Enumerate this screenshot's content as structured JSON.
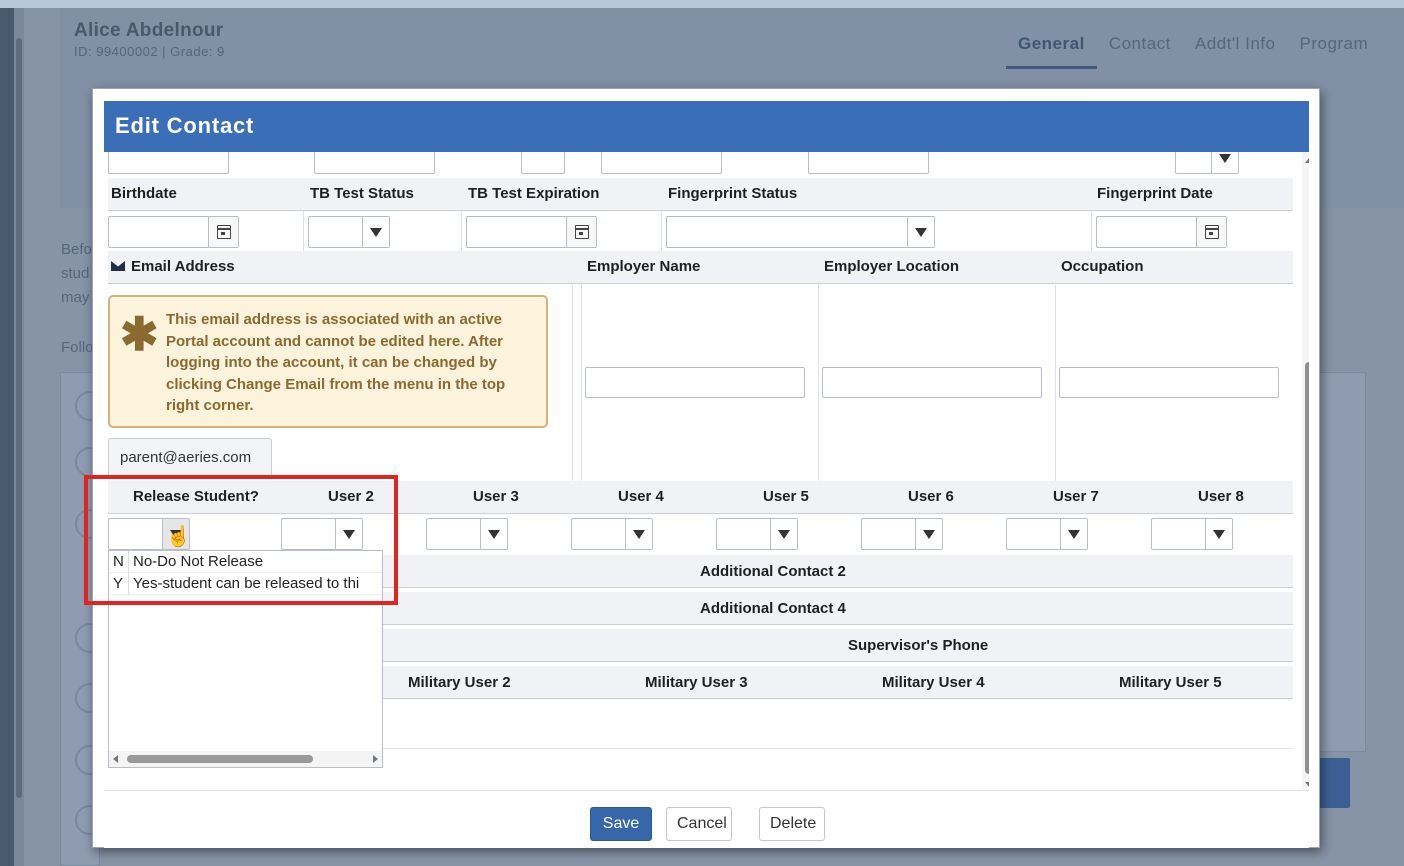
{
  "student": {
    "name": "Alice Abdelnour",
    "id_line": "ID: 99400002 |  Grade: 9"
  },
  "background_tabs": [
    "General",
    "Contact",
    "Addt'l Info",
    "Program"
  ],
  "background_text": [
    "Befo",
    "stud",
    "may",
    "Follo"
  ],
  "modal": {
    "title": "Edit Contact",
    "row1_headers": {
      "birthdate": "Birthdate",
      "tb_status": "TB Test Status",
      "tb_expiration": "TB Test Expiration",
      "fingerprint_status": "Fingerprint Status",
      "fingerprint_date": "Fingerprint Date"
    },
    "row2_headers": {
      "email": "Email Address",
      "employer_name": "Employer Name",
      "employer_location": "Employer Location",
      "occupation": "Occupation"
    },
    "warning_text": "This email address is associated with an active Portal account and cannot be edited here. After logging into the account, it can be changed by clicking Change Email from the menu in the top right corner.",
    "email_value": "parent@aeries.com",
    "row3_headers": {
      "release_student": "Release Student?",
      "user2": "User 2",
      "user3": "User 3",
      "user4": "User 4",
      "user5": "User 5",
      "user6": "User 6",
      "user7": "User 7",
      "user8": "User 8"
    },
    "release_options": [
      {
        "code": "N",
        "label": "No-Do Not Release"
      },
      {
        "code": "Y",
        "label": "Yes-student can be released to thi"
      }
    ],
    "groups": {
      "additional_contact_2": "Additional Contact 2",
      "additional_contact_4": "Additional Contact 4",
      "supervisor_phone": "Supervisor's Phone",
      "military_user_2": "Military User 2",
      "military_user_3": "Military User 3",
      "military_user_4": "Military User 4",
      "military_user_5": "Military User 5"
    },
    "buttons": {
      "save": "Save",
      "cancel": "Cancel",
      "delete": "Delete"
    }
  },
  "colors": {
    "title_bar": "#3a6fb7",
    "save_button": "#3766ab",
    "highlight": "#e0241f",
    "warning_bg": "#fcf3dd",
    "warning_text": "#8a6a2e"
  }
}
